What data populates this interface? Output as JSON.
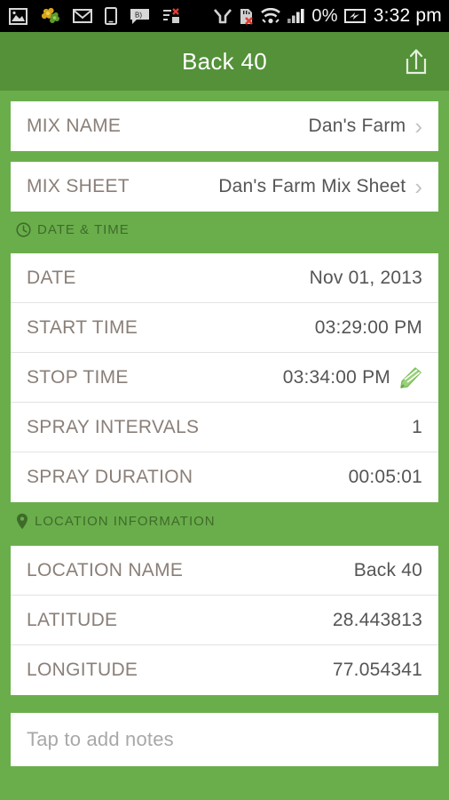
{
  "statusbar": {
    "left_icons": [
      {
        "name": "gallery-image-icon"
      },
      {
        "name": "flower-photos-icon"
      },
      {
        "name": "gmail-icon"
      },
      {
        "name": "device-tablet-icon"
      },
      {
        "name": "messaging-bubble-icon"
      },
      {
        "name": "task-list-error-icon"
      }
    ],
    "right_icons": [
      {
        "name": "connection-icon"
      },
      {
        "name": "sd-card-removed-icon"
      },
      {
        "name": "wifi-icon"
      },
      {
        "name": "cellular-signal-icon"
      }
    ],
    "battery_percent": "0%",
    "battery_icon": "battery-charging-icon",
    "clock": "3:32 pm"
  },
  "appbar": {
    "title": "Back 40",
    "share_icon": "share-icon"
  },
  "mix_card": {
    "rows": [
      {
        "label": "MIX NAME",
        "value": "Dan's Farm",
        "chevron": "›"
      },
      {
        "label": "MIX SHEET",
        "value": "Dan's Farm Mix Sheet",
        "chevron": "›"
      }
    ]
  },
  "date_time_section": {
    "icon": "clock-icon",
    "title": "DATE & TIME",
    "rows": [
      {
        "label": "DATE",
        "value": "Nov 01, 2013"
      },
      {
        "label": "START TIME",
        "value": "03:29:00 PM"
      },
      {
        "label": "STOP TIME",
        "value": "03:34:00 PM",
        "edit_icon": "pencil-edit-icon"
      },
      {
        "label": "SPRAY INTERVALS",
        "value": "1"
      },
      {
        "label": "SPRAY DURATION",
        "value": "00:05:01"
      }
    ]
  },
  "location_section": {
    "icon": "map-pin-icon",
    "title": "LOCATION INFORMATION",
    "rows": [
      {
        "label": "LOCATION NAME",
        "value": "Back 40"
      },
      {
        "label": "LATITUDE",
        "value": "28.443813"
      },
      {
        "label": "LONGITUDE",
        "value": "77.054341"
      }
    ]
  },
  "notes": {
    "placeholder": "Tap to add notes",
    "value": ""
  },
  "colors": {
    "background_green": "#6aae4c",
    "appbar_green": "#549139",
    "section_title_green": "#3f6b2a",
    "label_taupe": "#8a7f78",
    "value_gray": "#555555",
    "edit_icon_green": "#7bc05a"
  }
}
